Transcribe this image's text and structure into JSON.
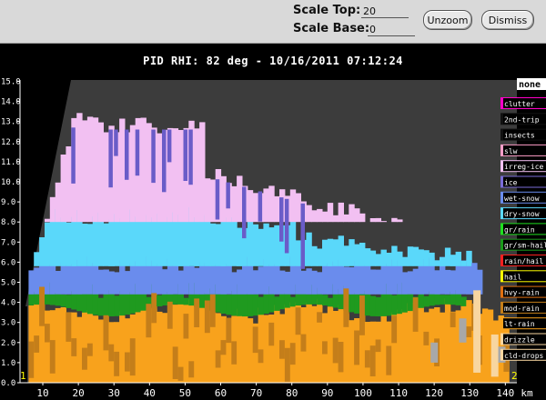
{
  "toolbar": {
    "scale_top_label": "Scale Top:",
    "scale_top_value": "20",
    "scale_base_label": "Scale Base:",
    "scale_base_value": "0",
    "unzoom_label": "Unzoom",
    "dismiss_label": "Dismiss"
  },
  "plot": {
    "title": "PID  RHI: 82 deg  -  10/16/2011 07:12:24",
    "y_ticks": [
      "0.0",
      "1.0",
      "2.0",
      "3.0",
      "4.0",
      "5.0",
      "6.0",
      "7.0",
      "8.0",
      "9.0",
      "10.0",
      "11.0",
      "12.0",
      "13.0",
      "14.0",
      "15.0"
    ],
    "x_ticks": [
      "10",
      "20",
      "30",
      "40",
      "50",
      "60",
      "70",
      "80",
      "90",
      "100",
      "110",
      "120",
      "130",
      "140"
    ],
    "x_unit": "km",
    "corner_left": "1",
    "corner_right": "2",
    "colors": {
      "background": "#3c3c3c",
      "blocked": "#000000",
      "drizzle_orange": "#f8a21c",
      "lt_rain_brown": "#c47e1a",
      "mod_rain_green": "#1f9a1f",
      "wet_snow_blue": "#6a8ced",
      "dry_snow_cyan": "#5ad8fa",
      "ice_pink": "#f2c0f2",
      "ice_purple": "#6a5cc8",
      "tan": "#f8d6a0",
      "grey": "#a8a8a8"
    }
  },
  "legend": {
    "title": "none",
    "items": [
      {
        "label": "clutter",
        "color": "#ff00c8"
      },
      {
        "label": "2nd-trip",
        "color": "#111111"
      },
      {
        "label": "insects",
        "color": "#111111"
      },
      {
        "label": "slw",
        "color": "#ff9ec8"
      },
      {
        "label": "irreg-ice",
        "color": "#f2c0f2"
      },
      {
        "label": "ice",
        "color": "#7a6cd8"
      },
      {
        "label": "wet-snow",
        "color": "#6a8ced"
      },
      {
        "label": "dry-snow",
        "color": "#5ad8fa"
      },
      {
        "label": "gr/rain",
        "color": "#20e020"
      },
      {
        "label": "gr/sm-hail",
        "color": "#1a9a1a"
      },
      {
        "label": "rain/hail",
        "color": "#ff2020"
      },
      {
        "label": "hail",
        "color": "#ffff00"
      },
      {
        "label": "hvy-rain",
        "color": "#e07010"
      },
      {
        "label": "mod-rain",
        "color": "#c47e1a"
      },
      {
        "label": "lt-rain",
        "color": "#f8a21c"
      },
      {
        "label": "drizzle",
        "color": "#f8d6a0"
      },
      {
        "label": "cld-drops",
        "color": "#f8d6a0"
      }
    ]
  }
}
